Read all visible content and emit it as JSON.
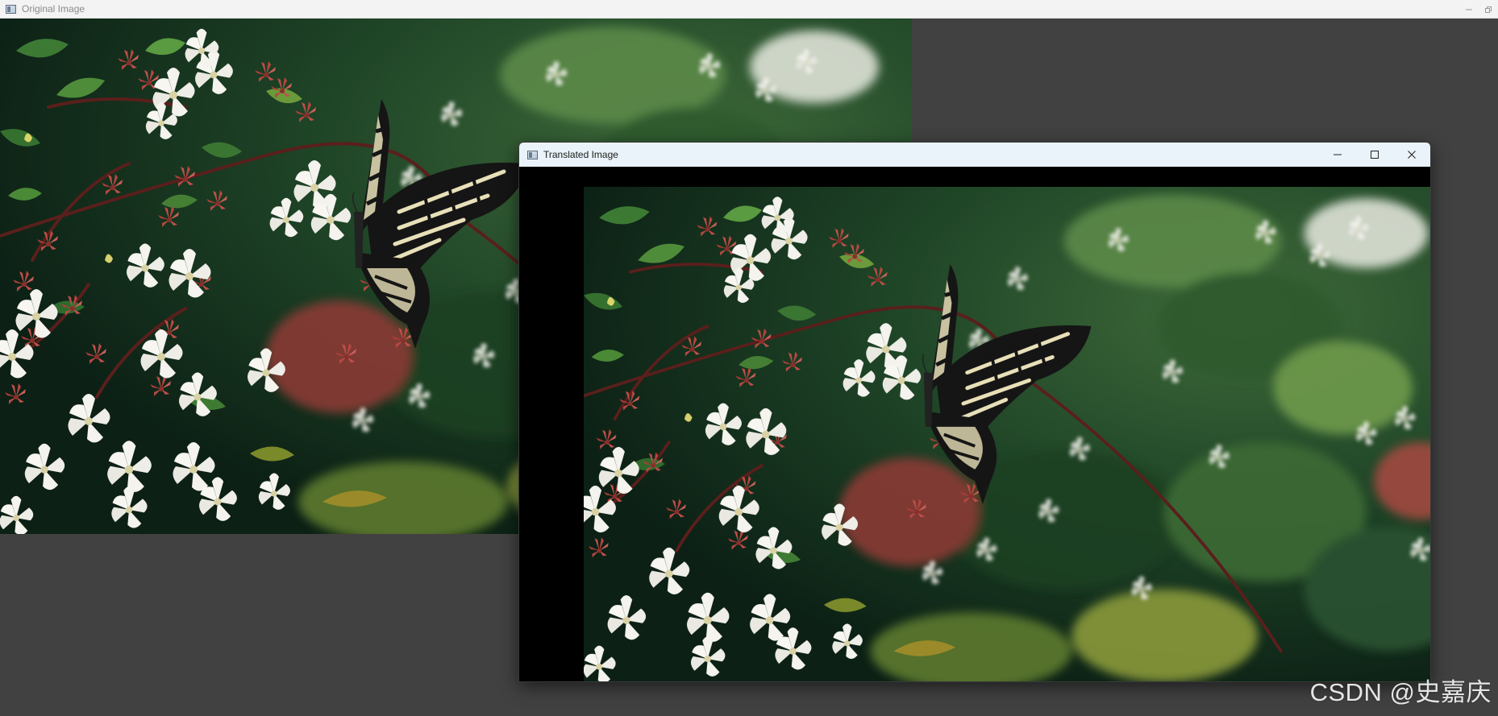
{
  "windows": {
    "original": {
      "title": "Original Image",
      "icon": "window-app-icon"
    },
    "translated": {
      "title": "Translated Image",
      "icon": "window-app-icon",
      "controls": [
        "minimize",
        "maximize",
        "close"
      ]
    }
  },
  "photo": {
    "subject": "swallowtail butterfly on white and red abelia flowers",
    "colors": {
      "foliage_dark": "#0f2a1a",
      "foliage_mid": "#2f5e2f",
      "leaf_light": "#4f8c3a",
      "petal_white": "#f2f1ec",
      "bud_red": "#c0504a",
      "wing_cream": "#e8e0b8",
      "wing_black": "#141414"
    }
  },
  "watermark": {
    "text": "CSDN @史嘉庆"
  },
  "colors": {
    "desktop_bg": "#414141",
    "titlebar_active": "#eaf3f9",
    "titlebar_inactive": "#f3f3f3",
    "translate_padding": "#000000"
  }
}
